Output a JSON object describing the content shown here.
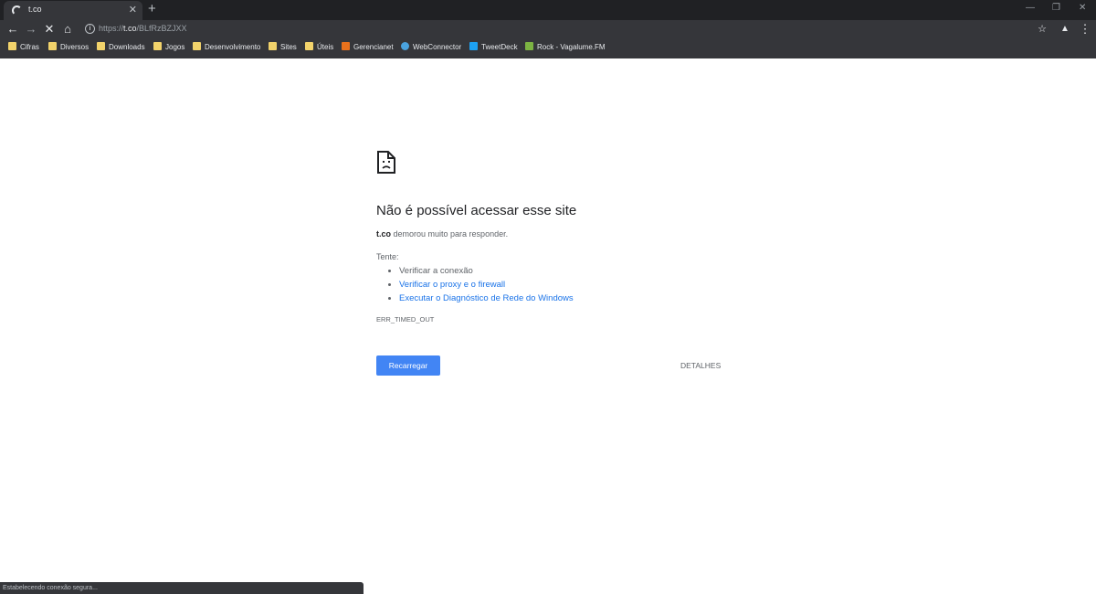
{
  "tab": {
    "title": "t.co"
  },
  "toolbar": {
    "url_host": "t.co",
    "url_scheme": "https://",
    "url_path": "/BLfRzBZJXX"
  },
  "bookmarks": [
    {
      "label": "Cifras",
      "icon": "folder-icon"
    },
    {
      "label": "Diversos",
      "icon": "folder-icon"
    },
    {
      "label": "Downloads",
      "icon": "folder-icon"
    },
    {
      "label": "Jogos",
      "icon": "folder-icon"
    },
    {
      "label": "Desenvolvimento",
      "icon": "folder-icon"
    },
    {
      "label": "Sites",
      "icon": "folder-icon"
    },
    {
      "label": "Úteis",
      "icon": "folder-icon"
    },
    {
      "label": "Gerencianet",
      "icon": "gerencianet-icon"
    },
    {
      "label": "WebConnector",
      "icon": "webconnector-icon"
    },
    {
      "label": "TweetDeck",
      "icon": "tweetdeck-icon"
    },
    {
      "label": "Rock - Vagalume.FM",
      "icon": "vagalume-icon"
    }
  ],
  "error": {
    "title": "Não é possível acessar esse site",
    "host": "t.co",
    "description": " demorou muito para responder.",
    "try_label": "Tente:",
    "suggestions": [
      "Verificar a conexão",
      "Verificar o proxy e o firewall",
      "Executar o Diagnóstico de Rede do Windows"
    ],
    "code": "ERR_TIMED_OUT",
    "reload_label": "Recarregar",
    "details_label": "DETALHES"
  },
  "status_bar": {
    "text": "Estabelecendo conexão segura..."
  },
  "colors": {
    "chrome_dark": "#35363a",
    "tabstrip": "#202124",
    "link": "#1a73e8",
    "button": "#4285f4"
  }
}
